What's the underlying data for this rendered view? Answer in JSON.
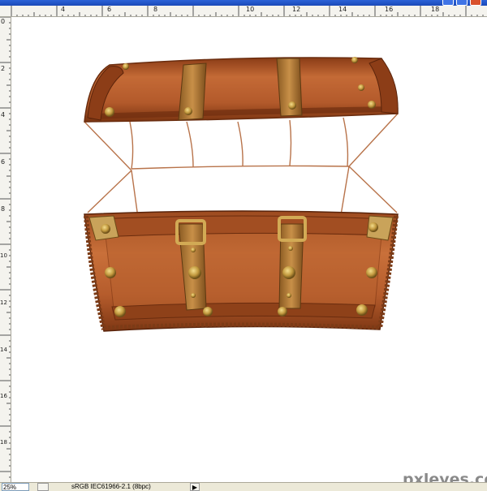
{
  "window": {
    "title": ""
  },
  "ruler_top": {
    "labels": [
      "4",
      "6",
      "8",
      "10",
      "12",
      "14",
      "16",
      "18"
    ]
  },
  "ruler_left": {
    "labels": [
      "0",
      "2",
      "4",
      "6",
      "8",
      "10",
      "12",
      "14",
      "16",
      "18"
    ]
  },
  "status": {
    "zoom": "25%",
    "doc_info": "sRGB IEC61966-2.1 (8bpc)"
  },
  "watermark": "pxleyes.com",
  "colors": {
    "wood_light": "#c76a36",
    "wood_dark": "#7a3411",
    "strap": "#b07a3a",
    "brass": "#c9a24a",
    "outline": "#b8734a"
  }
}
